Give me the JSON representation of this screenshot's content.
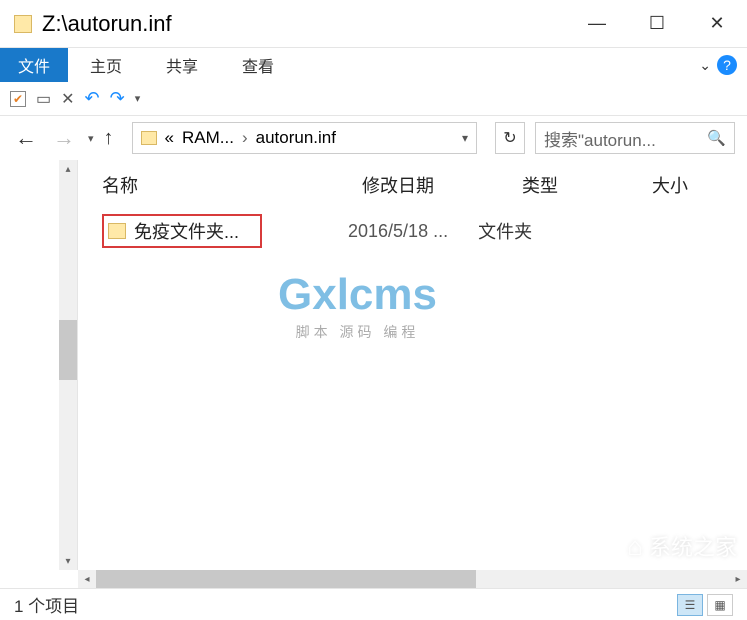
{
  "window": {
    "title": "Z:\\autorun.inf"
  },
  "ribbon": {
    "file": "文件",
    "tabs": [
      "主页",
      "共享",
      "查看"
    ]
  },
  "address": {
    "prefix": "«",
    "seg1": "RAM...",
    "seg2": "autorun.inf"
  },
  "search": {
    "placeholder": "搜索\"autorun..."
  },
  "columns": {
    "name": "名称",
    "date": "修改日期",
    "type": "类型",
    "size": "大小"
  },
  "files": [
    {
      "name": "免疫文件夹...",
      "date": "2016/5/18 ...",
      "type": "文件夹"
    }
  ],
  "watermark": {
    "logo": "Gxlcms",
    "sub": "脚本 源码 编程"
  },
  "watermark2": {
    "text": "系统之家"
  },
  "status": {
    "count": "1 个项目"
  }
}
